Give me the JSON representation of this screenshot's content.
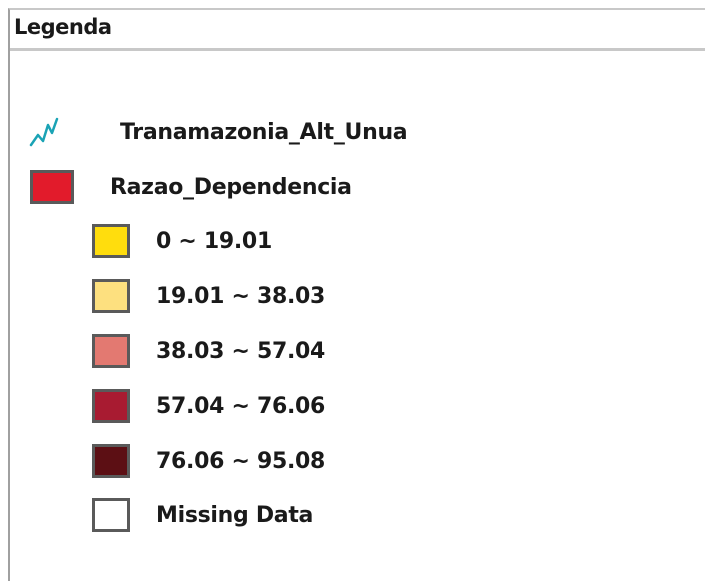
{
  "legend": {
    "title": "Legenda",
    "layers": [
      {
        "name": "Tranamazonia_Alt_Unua",
        "icon": "line-layer-icon",
        "icon_color": "#1aa3b5"
      },
      {
        "name": "Razao_Dependencia",
        "icon": "polygon-layer-icon",
        "symbol_color": "#e21b2b",
        "classes": [
          {
            "label": "0 ~ 19.01",
            "color": "#ffdd0d"
          },
          {
            "label": "19.01 ~ 38.03",
            "color": "#fde07f"
          },
          {
            "label": "38.03 ~ 57.04",
            "color": "#e37971"
          },
          {
            "label": "57.04 ~ 76.06",
            "color": "#a81b31"
          },
          {
            "label": "76.06 ~ 95.08",
            "color": "#5c0f14"
          },
          {
            "label": "Missing Data",
            "color": "#ffffff"
          }
        ]
      }
    ]
  }
}
